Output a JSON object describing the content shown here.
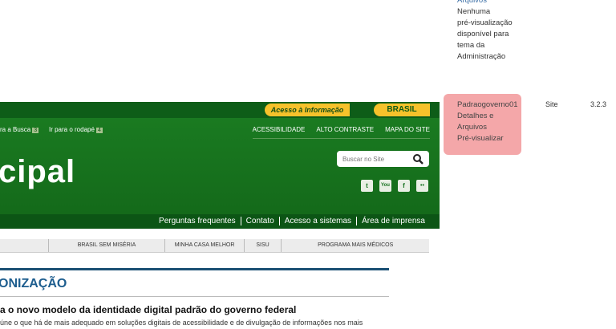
{
  "upper_row": {
    "lines": [
      "Arquivos",
      "Nenhuma",
      "pré-visualização",
      "disponível para",
      "tema da",
      "Administração"
    ]
  },
  "theme_row": {
    "name_lines": [
      "Padraogoverno01",
      "Detalhes e",
      "Arquivos",
      "Pré-visualizar"
    ],
    "type": "Site",
    "version": "3.2.3"
  },
  "preview": {
    "top_bar": {
      "access_label": "Acesso à Informação",
      "brasil_label": "BRASIL"
    },
    "skip_links": [
      {
        "label": "ra a Busca",
        "num": "3"
      },
      {
        "label": "Ir para o rodapé",
        "num": "4"
      }
    ],
    "top_links": [
      "ACESSIBILIDADE",
      "ALTO CONTRASTE",
      "MAPA DO SITE"
    ],
    "site_title": "cipal",
    "search_placeholder": "Buscar no Site",
    "social": [
      "t",
      "You",
      "f",
      "••"
    ],
    "nav": [
      "Perguntas frequentes",
      "Contato",
      "Acesso a sistemas",
      "Área de imprensa"
    ],
    "tabs": [
      "BRASIL SEM MISÉRIA",
      "MINHA CASA MELHOR",
      "SISU",
      "PROGRAMA MAIS MÉDICOS"
    ],
    "section_title": "ONIZAÇÃO",
    "article_title": "a o novo modelo da identidade digital padrão do governo federal",
    "article_body": "úne o que há de mais adequado em soluções digitais de acessibilidade e de divulgação de informações nos mais"
  }
}
